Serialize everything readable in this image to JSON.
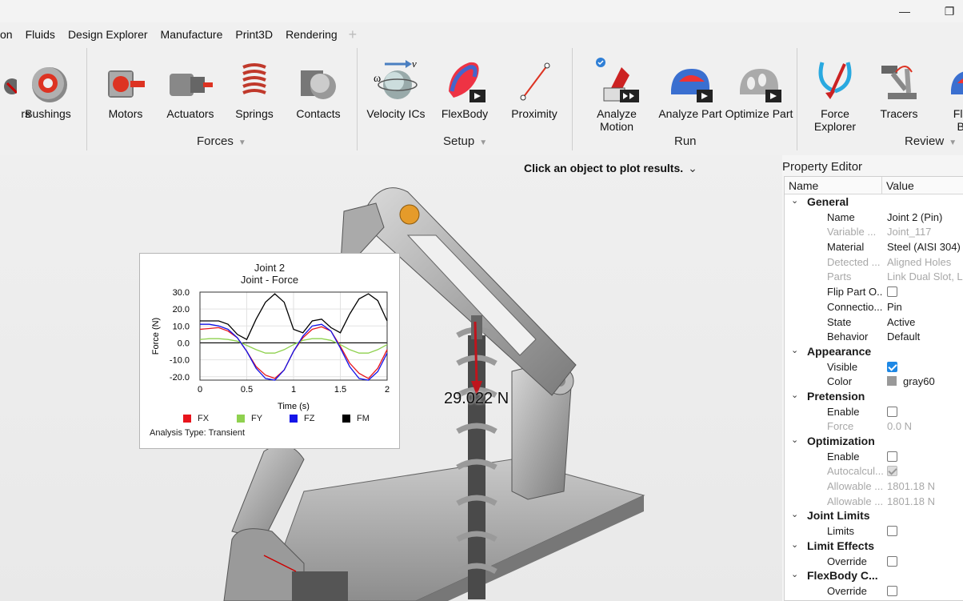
{
  "menu": {
    "tabs": [
      "on",
      "Fluids",
      "Design Explorer",
      "Manufacture",
      "Print3D",
      "Rendering"
    ],
    "add_tab": "+"
  },
  "window": {
    "minimize": "—",
    "restore": "❐"
  },
  "ribbon": {
    "tools": {
      "partial": "rs",
      "bushings": "Bushings",
      "motors": "Motors",
      "actuators": "Actuators",
      "springs": "Springs",
      "contacts": "Contacts",
      "velocity": "Velocity ICs",
      "flexbody": "FlexBody",
      "proximity": "Proximity",
      "analyze_motion": "Analyze Motion",
      "analyze_part": "Analyze Part",
      "optimize_part": "Optimize Part",
      "force_explorer_1": "Force",
      "force_explorer_2": "Explorer",
      "tracers": "Tracers",
      "flex_bo_1": "Flex",
      "flex_bo_2": "Bo"
    },
    "groups": {
      "forces": "Forces",
      "setup": "Setup",
      "run": "Run",
      "review": "Review"
    },
    "velocity_symbols": {
      "omega": "ω",
      "v": "v"
    }
  },
  "viewport": {
    "hint": "Click an object to plot results.",
    "hint_chevron": "⌄",
    "force_readout": "29.022 N"
  },
  "plot": {
    "title": "Joint 2",
    "subtitle": "Joint - Force",
    "analysis": "Analysis Type: Transient",
    "legend": [
      {
        "name": "FX",
        "color": "#e8141c"
      },
      {
        "name": "FY",
        "color": "#8fd14f"
      },
      {
        "name": "FZ",
        "color": "#1414e8"
      },
      {
        "name": "FM",
        "color": "#000000"
      }
    ]
  },
  "chart_data": {
    "type": "line",
    "title": "Joint 2",
    "subtitle": "Joint - Force",
    "xlabel": "Time (s)",
    "ylabel": "Force (N)",
    "xlim": [
      0,
      2
    ],
    "ylim": [
      -22,
      30
    ],
    "xticks": [
      "0",
      "0.5",
      "1",
      "1.5",
      "2"
    ],
    "yticks": [
      "30.0",
      "20.0",
      "10.0",
      "0.0",
      "-10.0",
      "-20.0"
    ],
    "x": [
      0,
      0.1,
      0.2,
      0.3,
      0.4,
      0.5,
      0.6,
      0.7,
      0.8,
      0.9,
      1.0,
      1.1,
      1.2,
      1.3,
      1.4,
      1.5,
      1.6,
      1.7,
      1.8,
      1.9,
      2.0
    ],
    "series": [
      {
        "name": "FX",
        "color": "#e8141c",
        "values": [
          8,
          8.5,
          9,
          7,
          3,
          -5,
          -14,
          -19,
          -21,
          -16,
          -5,
          3,
          8,
          9.5,
          7,
          -2,
          -12,
          -18,
          -21,
          -15,
          -4
        ]
      },
      {
        "name": "FY",
        "color": "#8fd14f",
        "values": [
          2,
          2.5,
          2.5,
          2,
          1,
          -1.5,
          -4,
          -6,
          -6,
          -4,
          -1,
          1.5,
          2.5,
          2.5,
          1.5,
          -1,
          -4,
          -6,
          -6,
          -4,
          -1
        ]
      },
      {
        "name": "FZ",
        "color": "#1414e8",
        "values": [
          11,
          11,
          10,
          8,
          3,
          -5,
          -15,
          -21,
          -22,
          -16,
          -5,
          4,
          10,
          11,
          7,
          -3,
          -14,
          -21,
          -22,
          -17,
          -6
        ]
      },
      {
        "name": "FM",
        "color": "#000000",
        "values": [
          13,
          13,
          13,
          11,
          5,
          2,
          14,
          24,
          29,
          24,
          8,
          6,
          13,
          14,
          9,
          6,
          17,
          26,
          29,
          25,
          13
        ]
      }
    ]
  },
  "property_editor": {
    "title": "Property Editor",
    "col_name": "Name",
    "col_value": "Value",
    "rows": [
      {
        "type": "cat",
        "label": "General"
      },
      {
        "type": "prop",
        "name": "Name",
        "value": "Joint 2 (Pin)"
      },
      {
        "type": "prop",
        "name": "Variable ...",
        "value": "Joint_117",
        "dim": true
      },
      {
        "type": "prop",
        "name": "Material",
        "value": "Steel (AISI 304)"
      },
      {
        "type": "prop",
        "name": "Detected ...",
        "value": "Aligned Holes",
        "dim": true
      },
      {
        "type": "prop",
        "name": "Parts",
        "value": "Link Dual Slot, L",
        "dim": true
      },
      {
        "type": "check",
        "name": "Flip Part O...",
        "checked": false
      },
      {
        "type": "prop",
        "name": "Connectio...",
        "value": "Pin"
      },
      {
        "type": "prop",
        "name": "State",
        "value": "Active"
      },
      {
        "type": "prop",
        "name": "Behavior",
        "value": "Default"
      },
      {
        "type": "cat",
        "label": "Appearance"
      },
      {
        "type": "check",
        "name": "Visible",
        "checked": true
      },
      {
        "type": "color",
        "name": "Color",
        "value": "gray60"
      },
      {
        "type": "cat",
        "label": "Pretension"
      },
      {
        "type": "check",
        "name": "Enable",
        "checked": false
      },
      {
        "type": "prop",
        "name": "Force",
        "value": "0.0 N",
        "dim": true
      },
      {
        "type": "cat",
        "label": "Optimization"
      },
      {
        "type": "check",
        "name": "Enable",
        "checked": false
      },
      {
        "type": "check",
        "name": "Autocalcul...",
        "checked": true,
        "dim": true
      },
      {
        "type": "prop",
        "name": "Allowable ...",
        "value": "1801.18 N",
        "dim": true
      },
      {
        "type": "prop",
        "name": "Allowable ...",
        "value": "1801.18 N",
        "dim": true
      },
      {
        "type": "cat",
        "label": "Joint Limits"
      },
      {
        "type": "check",
        "name": "Limits",
        "checked": false
      },
      {
        "type": "cat",
        "label": "Limit Effects"
      },
      {
        "type": "check",
        "name": "Override",
        "checked": false
      },
      {
        "type": "cat",
        "label": "FlexBody C..."
      },
      {
        "type": "check",
        "name": "Override",
        "checked": false
      }
    ]
  }
}
